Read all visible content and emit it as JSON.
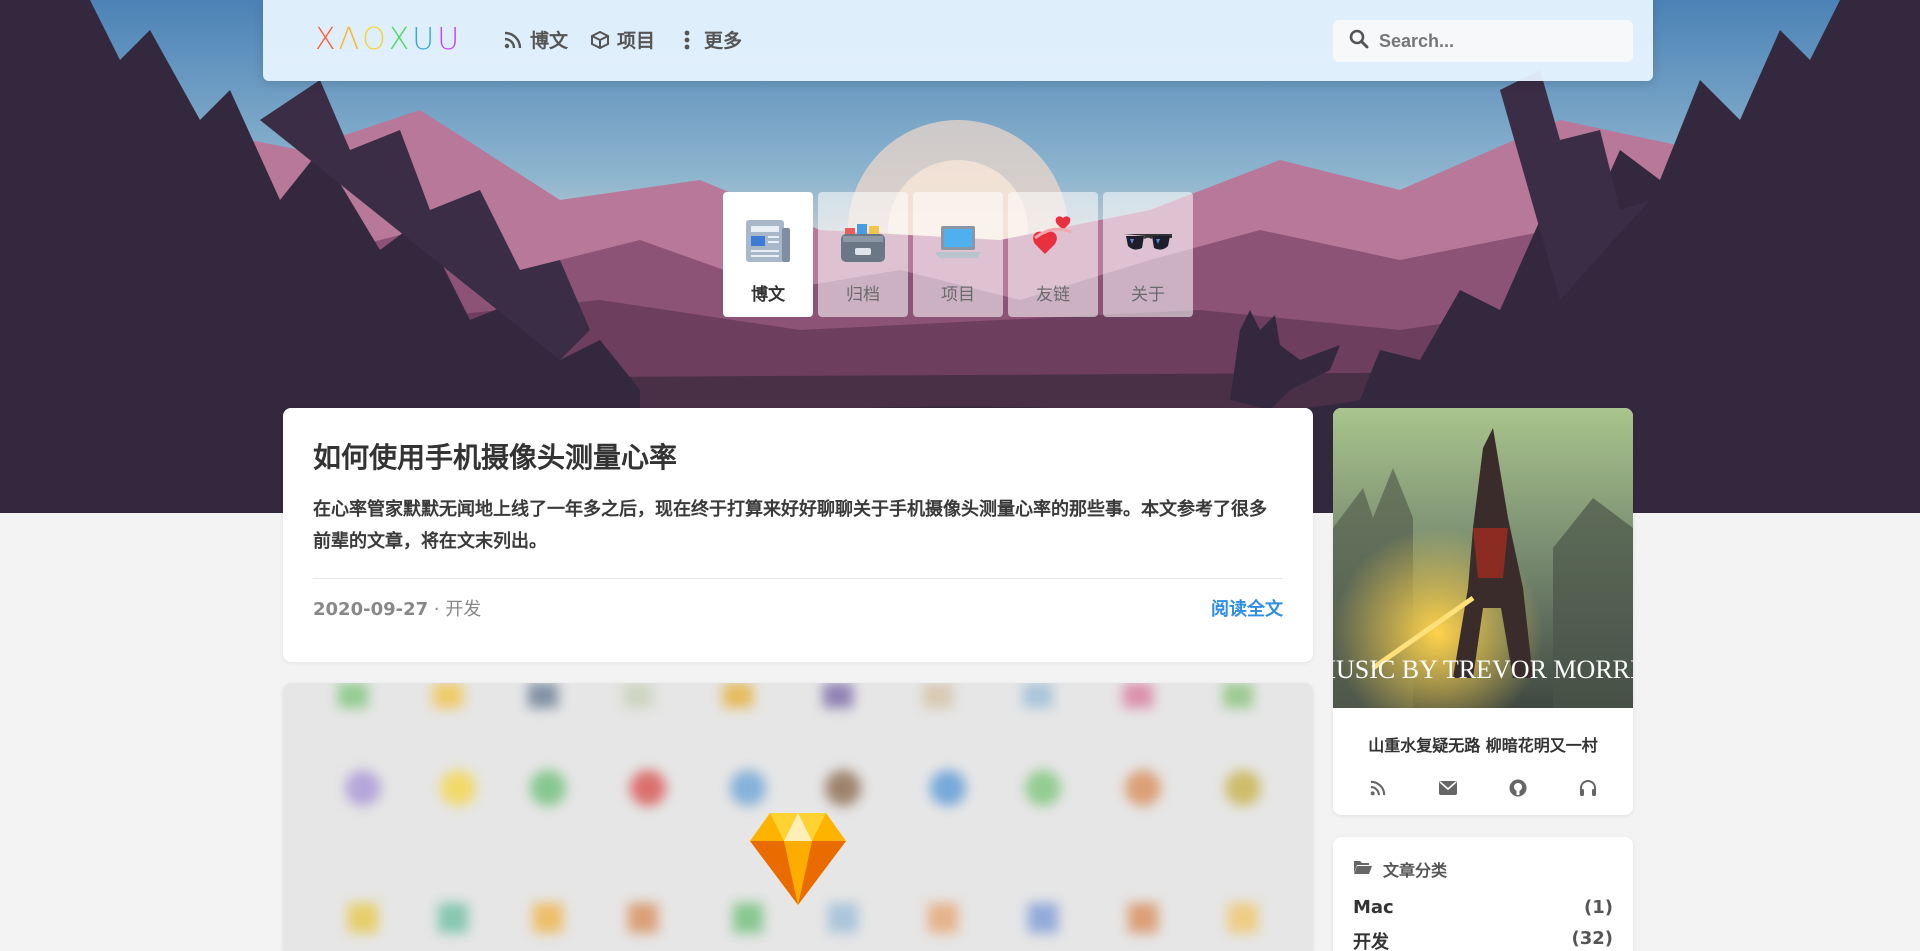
{
  "navbar": {
    "logo_letters": [
      {
        "char": "X",
        "color": "#ff5e3a"
      },
      {
        "char": "Λ",
        "color": "#f8b62d"
      },
      {
        "char": "O",
        "color": "#f5d33b"
      },
      {
        "char": "X",
        "color": "#4cd964"
      },
      {
        "char": "U",
        "color": "#34aadc"
      },
      {
        "char": "U",
        "color": "#c644fc"
      }
    ],
    "links": [
      {
        "label": "博文",
        "icon": "rss-icon"
      },
      {
        "label": "项目",
        "icon": "cube-icon"
      },
      {
        "label": "更多",
        "icon": "more-vertical-icon"
      }
    ],
    "search_placeholder": "Search..."
  },
  "tiles": [
    {
      "label": "博文",
      "icon": "newspaper-icon",
      "active": true
    },
    {
      "label": "归档",
      "icon": "archive-box-icon",
      "active": false
    },
    {
      "label": "项目",
      "icon": "laptop-icon",
      "active": false
    },
    {
      "label": "友链",
      "icon": "hearts-icon",
      "active": false
    },
    {
      "label": "关于",
      "icon": "sunglasses-icon",
      "active": false
    }
  ],
  "post": {
    "title": "如何使用手机摄像头测量心率",
    "excerpt": "在心率管家默默无闻地上线了一年多之后，现在终于打算来好好聊聊关于手机摄像头测量心率的那些事。本文参考了很多前辈的文章，将在文末列出。",
    "date": "2020-09-27",
    "separator": " · ",
    "category": "开发",
    "read_more": "阅读全文"
  },
  "profile": {
    "art_caption": "MUSIC BY TREVOR MORRIS",
    "motto": "山重水复疑无路 柳暗花明又一村",
    "socials": [
      "rss-icon",
      "mail-icon",
      "github-icon",
      "headphones-icon"
    ]
  },
  "categories": {
    "heading": "文章分类",
    "items": [
      {
        "name": "Mac",
        "count": "(1)"
      },
      {
        "name": "开发",
        "count": "(32)"
      }
    ]
  },
  "colors": {
    "accent": "#2f8ee4",
    "sky_top": "#4a7fb3",
    "mountain_pink": "#b0708f",
    "forest_dark": "#33283d"
  }
}
